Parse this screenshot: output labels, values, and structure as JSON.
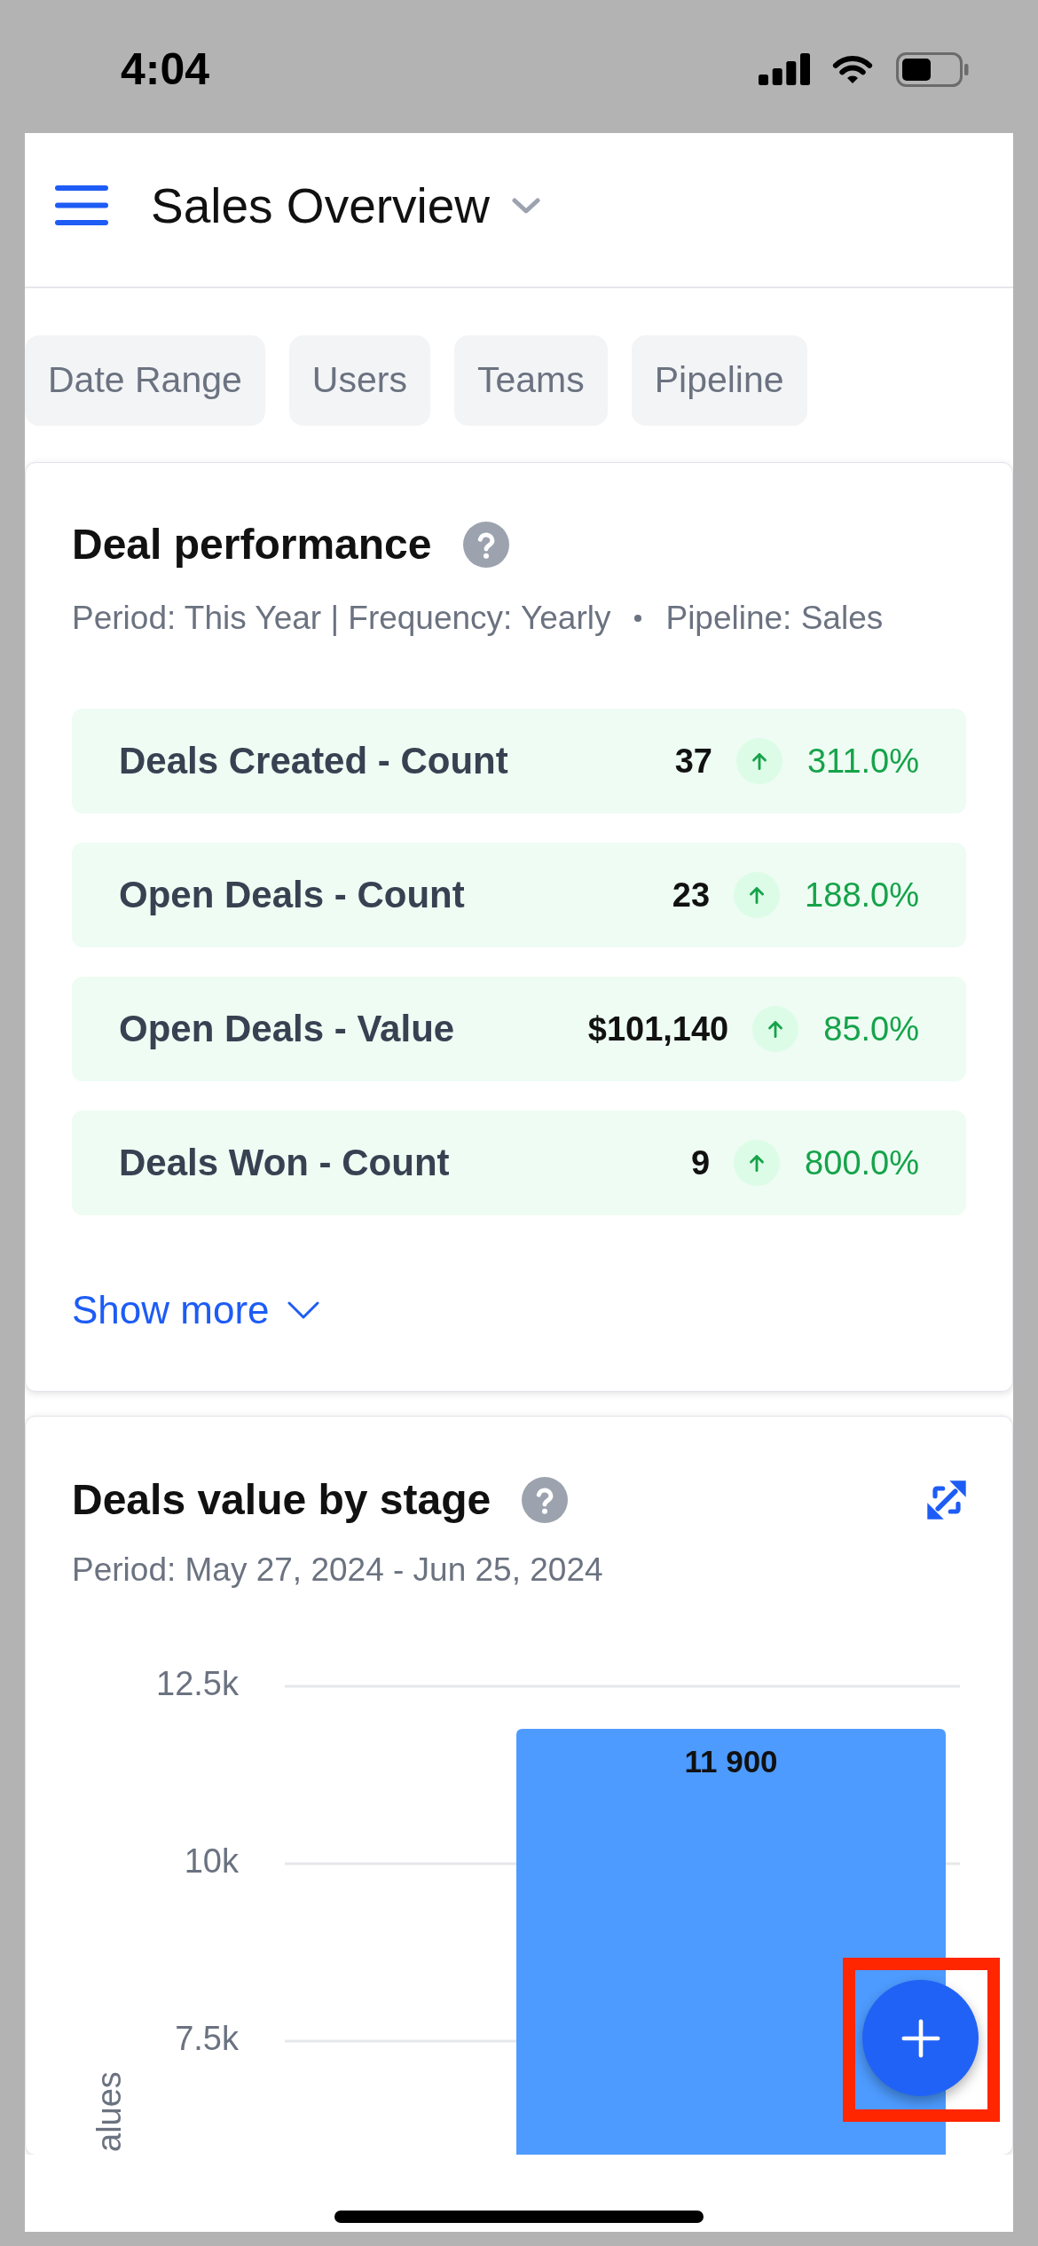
{
  "status_bar": {
    "time": "4:04"
  },
  "header": {
    "title": "Sales Overview"
  },
  "filters": [
    {
      "label": "Date Range"
    },
    {
      "label": "Users"
    },
    {
      "label": "Teams"
    },
    {
      "label": "Pipeline"
    }
  ],
  "deal_performance": {
    "title": "Deal performance",
    "meta": [
      "Period: This Year | Frequency: Yearly",
      "Pipeline: Sales"
    ],
    "metrics": [
      {
        "label": "Deals Created - Count",
        "value": "37",
        "rising": true,
        "change": "311.0%"
      },
      {
        "label": "Open Deals - Count",
        "value": "23",
        "rising": true,
        "change": "188.0%"
      },
      {
        "label": "Open Deals - Value",
        "value": "$101,140",
        "rising": true,
        "change": "85.0%"
      },
      {
        "label": "Deals Won - Count",
        "value": "9",
        "rising": true,
        "change": "800.0%"
      }
    ],
    "show_more": {
      "label": "Show more",
      "expanded": false
    }
  },
  "deals_value_by_stage": {
    "title": "Deals value by stage",
    "subtitle": "Period: May 27, 2024 - Jun 25, 2024",
    "chart_data": {
      "type": "bar",
      "ylabel": "alues",
      "values": [
        11900
      ],
      "value_labels": [
        "11 900"
      ],
      "ylim": [
        5900,
        12500
      ],
      "yticks": [
        {
          "value": 7500,
          "label": "7.5k"
        },
        {
          "value": 10000,
          "label": "10k"
        },
        {
          "value": 12500,
          "label": "12.5k"
        }
      ]
    }
  }
}
